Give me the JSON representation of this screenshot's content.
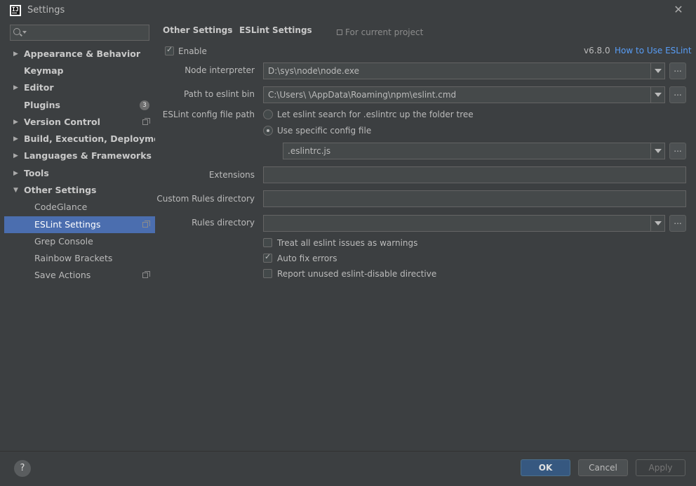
{
  "window": {
    "title": "Settings",
    "close_glyph": "✕"
  },
  "sidebar": {
    "search_placeholder": "",
    "items": [
      {
        "label": "Appearance & Behavior",
        "expanded": false,
        "bold": true
      },
      {
        "label": "Keymap",
        "bold": true
      },
      {
        "label": "Editor",
        "expanded": false,
        "bold": true
      },
      {
        "label": "Plugins",
        "bold": true,
        "badge": "3"
      },
      {
        "label": "Version Control",
        "expanded": false,
        "bold": true,
        "icon": "copy-icon"
      },
      {
        "label": "Build, Execution, Deployment",
        "expanded": false,
        "bold": true
      },
      {
        "label": "Languages & Frameworks",
        "expanded": false,
        "bold": true
      },
      {
        "label": "Tools",
        "expanded": false,
        "bold": true
      },
      {
        "label": "Other Settings",
        "expanded": true,
        "bold": true
      },
      {
        "label": "CodeGlance"
      },
      {
        "label": "ESLint Settings",
        "selected": true,
        "icon": "copy-icon"
      },
      {
        "label": "Grep Console"
      },
      {
        "label": "Rainbow Brackets"
      },
      {
        "label": "Save Actions",
        "icon": "copy-icon"
      }
    ]
  },
  "breadcrumb": {
    "parent": "Other Settings",
    "separator": "›",
    "current": "ESLint Settings",
    "scope": "For current project"
  },
  "eslint": {
    "enable_label": "Enable",
    "enable_checked": true,
    "version": "v6.8.0",
    "how_to_link": "How to Use ESLint",
    "node_interpreter_label": "Node interpreter",
    "node_interpreter_value": "D:\\sys\\node\\node.exe",
    "eslint_bin_label": "Path to eslint bin",
    "eslint_bin_value": "C:\\Users\\ \\AppData\\Roaming\\npm\\eslint.cmd",
    "config_label": "ESLint config file path",
    "radio_search_label": "Let eslint search for .eslintrc up the folder tree",
    "radio_specific_label": "Use specific config file",
    "config_file_value": ".eslintrc.js",
    "extensions_label": "Extensions",
    "extensions_value": "",
    "custom_rules_label": "Custom Rules directory",
    "custom_rules_value": "",
    "rules_dir_label": "Rules directory",
    "rules_dir_value": "",
    "treat_warnings_label": "Treat all eslint issues as warnings",
    "treat_warnings_checked": false,
    "auto_fix_label": "Auto fix errors",
    "auto_fix_checked": true,
    "report_unused_label": "Report unused eslint-disable directive",
    "report_unused_checked": false,
    "browse_label": "..."
  },
  "footer": {
    "help": "?",
    "ok": "OK",
    "cancel": "Cancel",
    "apply": "Apply"
  },
  "colors": {
    "background": "#3c3f41",
    "selection": "#4b6eaf",
    "link": "#589df6",
    "ok_button": "#365880"
  }
}
